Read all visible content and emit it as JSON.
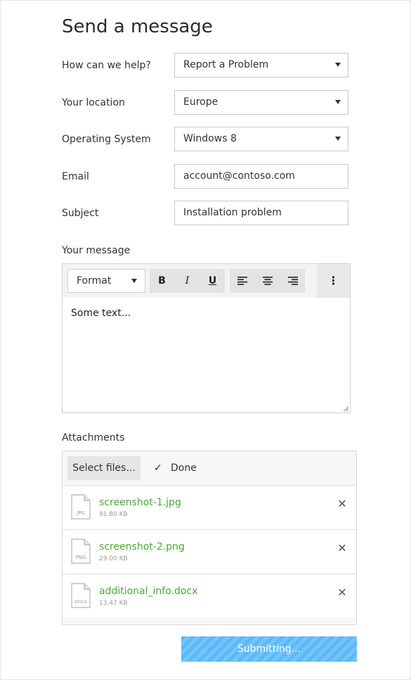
{
  "page": {
    "title": "Send a message"
  },
  "form": {
    "help": {
      "label": "How can we help?",
      "value": "Report a Problem"
    },
    "location": {
      "label": "Your location",
      "value": "Europe"
    },
    "os": {
      "label": "Operating System",
      "value": "Windows 8"
    },
    "email": {
      "label": "Email",
      "value": "account@contoso.com"
    },
    "subject": {
      "label": "Subject",
      "value": "Installation problem"
    }
  },
  "editor": {
    "label": "Your message",
    "format_label": "Format",
    "bold_label": "B",
    "italic_label": "I",
    "underline_label": "U",
    "content": "Some text..."
  },
  "attachments": {
    "label": "Attachments",
    "select_label": "Select files...",
    "done_label": "Done",
    "files": [
      {
        "name": "screenshot-1.jpg",
        "type": "JPG",
        "size": "91.80 KB"
      },
      {
        "name": "screenshot-2.png",
        "type": "PNG",
        "size": "29.00 KB"
      },
      {
        "name": "additional_info.docx",
        "type": "DOCX",
        "size": "13.47 KB"
      }
    ]
  },
  "submit": {
    "label": "Submitting..."
  },
  "colors": {
    "file_name": "#4ca838",
    "submit_bg": "#5db8f6",
    "toolbar_bg": "#f3f3f3"
  }
}
